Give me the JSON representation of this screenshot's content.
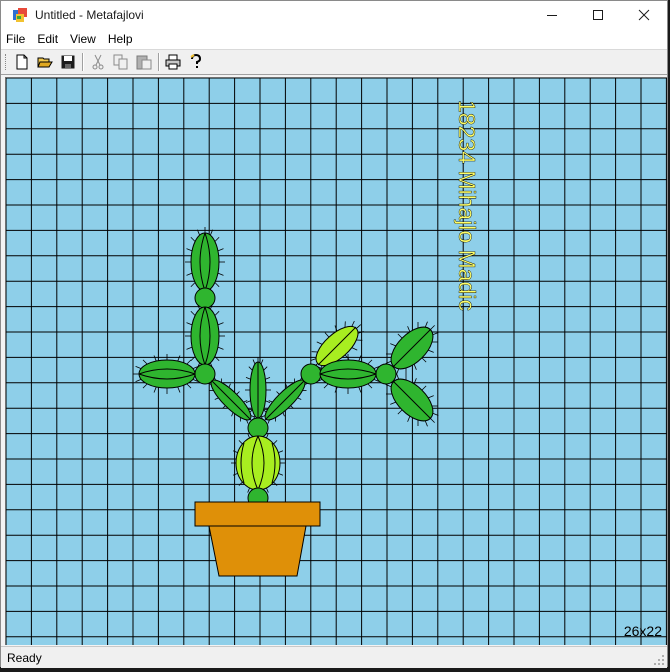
{
  "window": {
    "title": "Untitled - Metafajlovi",
    "controls": [
      "minimize",
      "maximize",
      "close"
    ]
  },
  "menu": [
    "File",
    "Edit",
    "View",
    "Help"
  ],
  "toolbar": {
    "buttons": [
      "new-icon",
      "open-icon",
      "save-icon",
      "cut-icon",
      "copy-icon",
      "paste-icon",
      "print-icon",
      "help-icon"
    ]
  },
  "canvas": {
    "background_color": "#8ecfe9",
    "grid_color": "#000000",
    "vertical_label": "18234 Mihajlo Madic",
    "vertical_label_color": "#ffff66",
    "grid_size_label": "26x22",
    "cactus_colors": {
      "dark_green": "#2fb52f",
      "light_green": "#a8ee20",
      "pot": "#df9008"
    }
  },
  "status": {
    "text": "Ready"
  }
}
